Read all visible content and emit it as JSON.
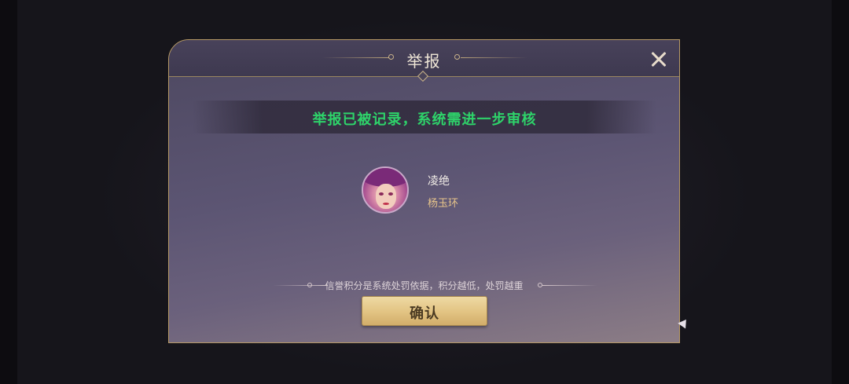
{
  "dialog": {
    "title": "举报",
    "close_icon": "close-icon",
    "status_message": "举报已被记录，系统需进一步审核",
    "status_color": "#2ed36a",
    "reported_player": {
      "name": "凌绝",
      "hero": "杨玉环",
      "avatar_icon": "hero-avatar"
    },
    "notice": "信誉积分是系统处罚依据，积分越低，处罚越重",
    "confirm_label": "确认"
  }
}
